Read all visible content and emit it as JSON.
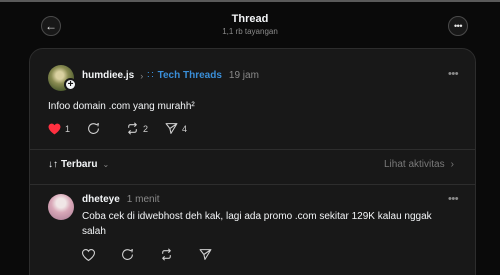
{
  "header": {
    "title": "Thread",
    "views": "1,1 rb tayangan"
  },
  "post": {
    "username": "humdiee.js",
    "topic": "Tech Threads",
    "time": "19 jam",
    "text": "Infoo domain .com yang murahh²",
    "likes": "1",
    "reposts": "2",
    "shares": "4"
  },
  "sort": {
    "label": "Terbaru",
    "activity_label": "Lihat aktivitas"
  },
  "reply": {
    "username": "dheteye",
    "time": "1 menit",
    "text": "Coba cek di idwebhost deh kak, lagi ada promo .com sekitar 129K kalau nggak salah"
  },
  "colors": {
    "like": "#ff3040",
    "topic": "#3a8fd9"
  },
  "icons": [
    "arrow-left-icon",
    "more-icon",
    "plus-icon",
    "chevron-right-icon",
    "heart-icon",
    "comment-icon",
    "repost-icon",
    "share-icon",
    "sort-icon",
    "chevron-down-icon"
  ]
}
